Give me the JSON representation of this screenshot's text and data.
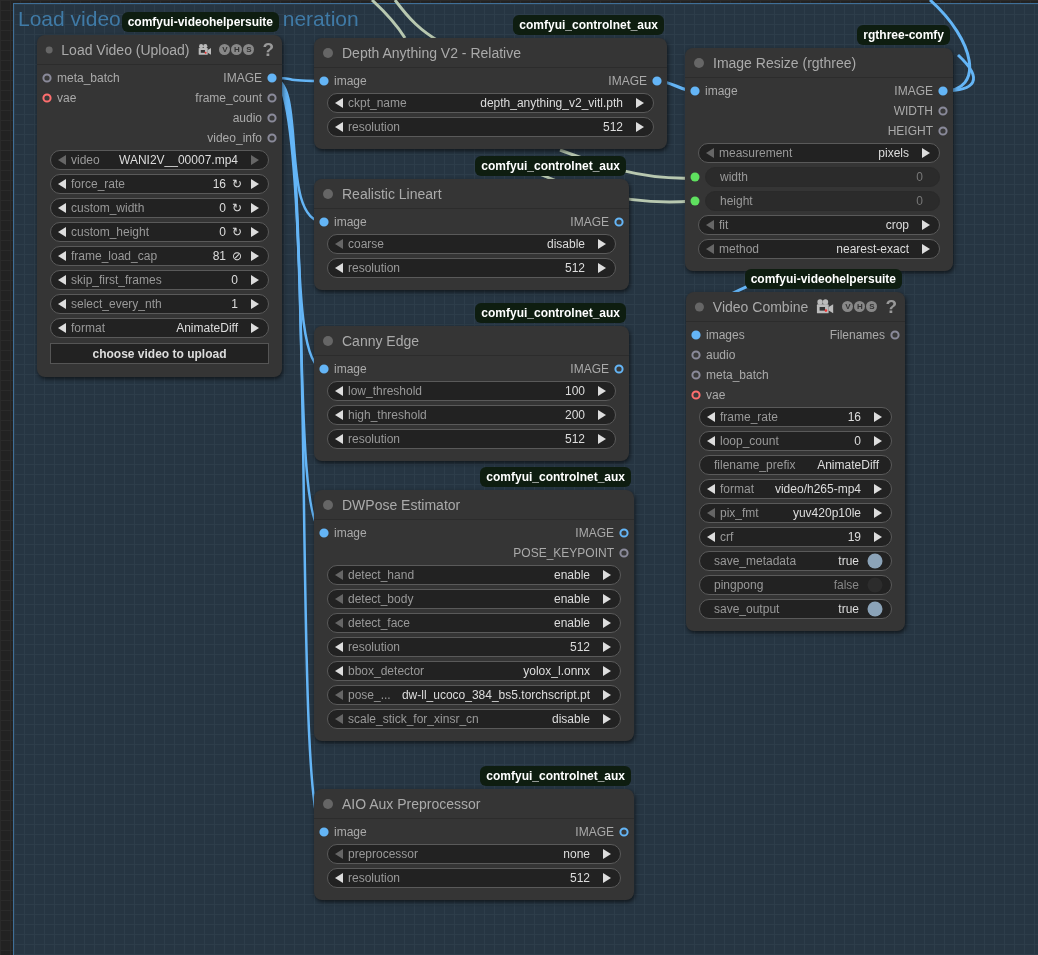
{
  "group": {
    "title_parts": [
      "Load video",
      "neration"
    ]
  },
  "nodes": [
    {
      "title": "Load Video (Upload)",
      "badge": "comfyui-videohelpersuite",
      "logo": [
        "V",
        "H",
        "S"
      ],
      "help": "?",
      "inputs": [
        {
          "name": "meta_batch",
          "color": "#8a8a9a",
          "connected": false
        },
        {
          "name": "vae",
          "color": "#ff6e6e",
          "connected": false
        }
      ],
      "outputs": [
        {
          "name": "IMAGE",
          "color": "#64b5f6",
          "connected": true
        },
        {
          "name": "frame_count",
          "color": "#8a8a9a",
          "connected": false
        },
        {
          "name": "audio",
          "color": "#8a8a9a",
          "connected": false
        },
        {
          "name": "video_info",
          "color": "#8a8a9a",
          "connected": false
        }
      ],
      "widgets": [
        {
          "kind": "combo",
          "label": "video",
          "value": "WANI2V__00007.mp4",
          "left_enabled": false,
          "right_enabled": false
        },
        {
          "kind": "combo",
          "label": "force_rate",
          "value": "16",
          "suffix": "↻",
          "left_enabled": true,
          "right_enabled": true
        },
        {
          "kind": "combo",
          "label": "custom_width",
          "value": "0",
          "suffix": "↻",
          "left_enabled": true,
          "right_enabled": true
        },
        {
          "kind": "combo",
          "label": "custom_height",
          "value": "0",
          "suffix": "↻",
          "left_enabled": true,
          "right_enabled": true
        },
        {
          "kind": "combo",
          "label": "frame_load_cap",
          "value": "81",
          "suffix": "⊘",
          "left_enabled": true,
          "right_enabled": true
        },
        {
          "kind": "combo",
          "label": "skip_first_frames",
          "value": "0",
          "left_enabled": true,
          "right_enabled": true
        },
        {
          "kind": "combo",
          "label": "select_every_nth",
          "value": "1",
          "left_enabled": true,
          "right_enabled": true
        },
        {
          "kind": "combo",
          "label": "format",
          "value": "AnimateDiff",
          "left_enabled": true,
          "right_enabled": true
        },
        {
          "kind": "button",
          "label": "choose video to upload"
        }
      ]
    },
    {
      "title": "Depth Anything V2 - Relative",
      "badge": "comfyui_controlnet_aux",
      "inputs": [
        {
          "name": "image",
          "color": "#64b5f6",
          "connected": true
        }
      ],
      "outputs": [
        {
          "name": "IMAGE",
          "color": "#64b5f6",
          "connected": true
        }
      ],
      "widgets": [
        {
          "kind": "combo",
          "label": "ckpt_name",
          "value": "depth_anything_v2_vitl.pth",
          "left_enabled": true,
          "right_enabled": true
        },
        {
          "kind": "combo",
          "label": "resolution",
          "value": "512",
          "left_enabled": true,
          "right_enabled": true
        }
      ]
    },
    {
      "title": "Realistic Lineart",
      "badge": "comfyui_controlnet_aux",
      "inputs": [
        {
          "name": "image",
          "color": "#64b5f6",
          "connected": true
        }
      ],
      "outputs": [
        {
          "name": "IMAGE",
          "color": "#64b5f6",
          "connected": false
        }
      ],
      "widgets": [
        {
          "kind": "combo",
          "label": "coarse",
          "value": "disable",
          "left_enabled": false,
          "right_enabled": true
        },
        {
          "kind": "combo",
          "label": "resolution",
          "value": "512",
          "left_enabled": true,
          "right_enabled": true
        }
      ]
    },
    {
      "title": "Canny Edge",
      "badge": "comfyui_controlnet_aux",
      "inputs": [
        {
          "name": "image",
          "color": "#64b5f6",
          "connected": true
        }
      ],
      "outputs": [
        {
          "name": "IMAGE",
          "color": "#64b5f6",
          "connected": false
        }
      ],
      "widgets": [
        {
          "kind": "combo",
          "label": "low_threshold",
          "value": "100",
          "left_enabled": true,
          "right_enabled": true
        },
        {
          "kind": "combo",
          "label": "high_threshold",
          "value": "200",
          "left_enabled": true,
          "right_enabled": true
        },
        {
          "kind": "combo",
          "label": "resolution",
          "value": "512",
          "left_enabled": true,
          "right_enabled": true
        }
      ]
    },
    {
      "title": "DWPose Estimator",
      "badge": "comfyui_controlnet_aux",
      "inputs": [
        {
          "name": "image",
          "color": "#64b5f6",
          "connected": true
        }
      ],
      "outputs": [
        {
          "name": "IMAGE",
          "color": "#64b5f6",
          "connected": false
        },
        {
          "name": "POSE_KEYPOINT",
          "color": "#8a8a9a",
          "connected": false
        }
      ],
      "widgets": [
        {
          "kind": "combo",
          "label": "detect_hand",
          "value": "enable",
          "left_enabled": false,
          "right_enabled": true
        },
        {
          "kind": "combo",
          "label": "detect_body",
          "value": "enable",
          "left_enabled": false,
          "right_enabled": true
        },
        {
          "kind": "combo",
          "label": "detect_face",
          "value": "enable",
          "left_enabled": false,
          "right_enabled": true
        },
        {
          "kind": "combo",
          "label": "resolution",
          "value": "512",
          "left_enabled": true,
          "right_enabled": true
        },
        {
          "kind": "combo",
          "label": "bbox_detector",
          "value": "yolox_l.onnx",
          "left_enabled": true,
          "right_enabled": true
        },
        {
          "kind": "combo",
          "label": "pose_...",
          "value": "dw-ll_ucoco_384_bs5.torchscript.pt",
          "left_enabled": false,
          "right_enabled": true
        },
        {
          "kind": "combo",
          "label": "scale_stick_for_xinsr_cn",
          "value": "disable",
          "left_enabled": false,
          "right_enabled": true
        }
      ]
    },
    {
      "title": "AIO Aux Preprocessor",
      "badge": "comfyui_controlnet_aux",
      "inputs": [
        {
          "name": "image",
          "color": "#64b5f6",
          "connected": true
        }
      ],
      "outputs": [
        {
          "name": "IMAGE",
          "color": "#64b5f6",
          "connected": false
        }
      ],
      "widgets": [
        {
          "kind": "combo",
          "label": "preprocessor",
          "value": "none",
          "left_enabled": false,
          "right_enabled": true
        },
        {
          "kind": "combo",
          "label": "resolution",
          "value": "512",
          "left_enabled": true,
          "right_enabled": true
        }
      ]
    },
    {
      "title": "Image Resize (rgthree)",
      "badge": "rgthree-comfy",
      "inputs": [
        {
          "name": "image",
          "color": "#64b5f6",
          "connected": true
        }
      ],
      "outputs": [
        {
          "name": "IMAGE",
          "color": "#64b5f6",
          "connected": true
        },
        {
          "name": "WIDTH",
          "color": "#8a8a9a",
          "connected": false
        },
        {
          "name": "HEIGHT",
          "color": "#8a8a9a",
          "connected": false
        }
      ],
      "widgets": [
        {
          "kind": "combo",
          "label": "measurement",
          "value": "pixels",
          "left_enabled": false,
          "right_enabled": true
        },
        {
          "kind": "converted",
          "label": "width",
          "value": "0"
        },
        {
          "kind": "converted",
          "label": "height",
          "value": "0"
        },
        {
          "kind": "combo",
          "label": "fit",
          "value": "crop",
          "left_enabled": false,
          "right_enabled": true
        },
        {
          "kind": "combo",
          "label": "method",
          "value": "nearest-exact",
          "left_enabled": false,
          "right_enabled": true
        }
      ]
    },
    {
      "title": "Video Combine",
      "badge": "comfyui-videohelpersuite",
      "logo": [
        "V",
        "H",
        "S"
      ],
      "help": "?",
      "inputs": [
        {
          "name": "images",
          "color": "#64b5f6",
          "connected": true
        },
        {
          "name": "audio",
          "color": "#8a8a9a",
          "connected": false
        },
        {
          "name": "meta_batch",
          "color": "#8a8a9a",
          "connected": false
        },
        {
          "name": "vae",
          "color": "#ff6e6e",
          "connected": false
        }
      ],
      "outputs": [
        {
          "name": "Filenames",
          "color": "#8a8a9a",
          "connected": false
        }
      ],
      "widgets": [
        {
          "kind": "combo",
          "label": "frame_rate",
          "value": "16",
          "left_enabled": true,
          "right_enabled": true
        },
        {
          "kind": "combo",
          "label": "loop_count",
          "value": "0",
          "left_enabled": true,
          "right_enabled": true
        },
        {
          "kind": "text",
          "label": "filename_prefix",
          "value": "AnimateDiff"
        },
        {
          "kind": "combo",
          "label": "format",
          "value": "video/h265-mp4",
          "left_enabled": true,
          "right_enabled": true
        },
        {
          "kind": "combo",
          "label": "pix_fmt",
          "value": "yuv420p10le",
          "left_enabled": false,
          "right_enabled": true
        },
        {
          "kind": "combo",
          "label": "crf",
          "value": "19",
          "left_enabled": true,
          "right_enabled": true
        },
        {
          "kind": "toggle",
          "label": "save_metadata",
          "value": "true",
          "on": true
        },
        {
          "kind": "toggle",
          "label": "pingpong",
          "value": "false",
          "on": false
        },
        {
          "kind": "toggle",
          "label": "save_output",
          "value": "true",
          "on": true
        }
      ]
    }
  ]
}
